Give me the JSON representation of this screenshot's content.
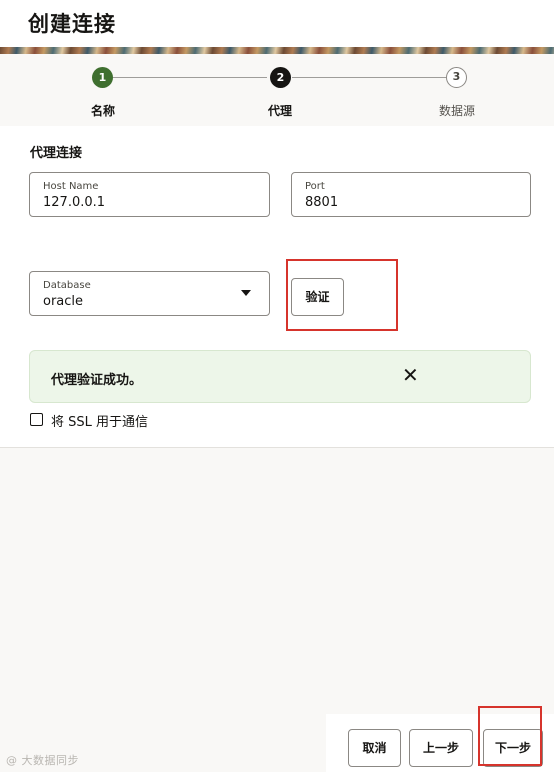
{
  "header": {
    "title": "创建连接"
  },
  "stepper": {
    "steps": [
      {
        "number": "1",
        "label": "名称",
        "state": "done"
      },
      {
        "number": "2",
        "label": "代理",
        "state": "active"
      },
      {
        "number": "3",
        "label": "数据源",
        "state": "todo"
      }
    ]
  },
  "proxy": {
    "section_title": "代理连接",
    "host": {
      "label": "Host Name",
      "value": "127.0.0.1"
    },
    "port": {
      "label": "Port",
      "value": "8801"
    },
    "database": {
      "label": "Database",
      "value": "oracle"
    },
    "verify_label": "验证",
    "success_message": "代理验证成功。",
    "ssl_label": "将 SSL 用于通信",
    "ssl_checked": false
  },
  "footer": {
    "cancel_label": "取消",
    "prev_label": "上一步",
    "next_label": "下一步"
  },
  "watermark": "@ 大数据同步",
  "colors": {
    "step_done": "#3f6f2f",
    "step_active": "#161513",
    "success_bg": "#edf6e9",
    "highlight": "#d6342c"
  },
  "icons": {
    "close": "close-icon",
    "dropdown": "chevron-down-icon"
  }
}
